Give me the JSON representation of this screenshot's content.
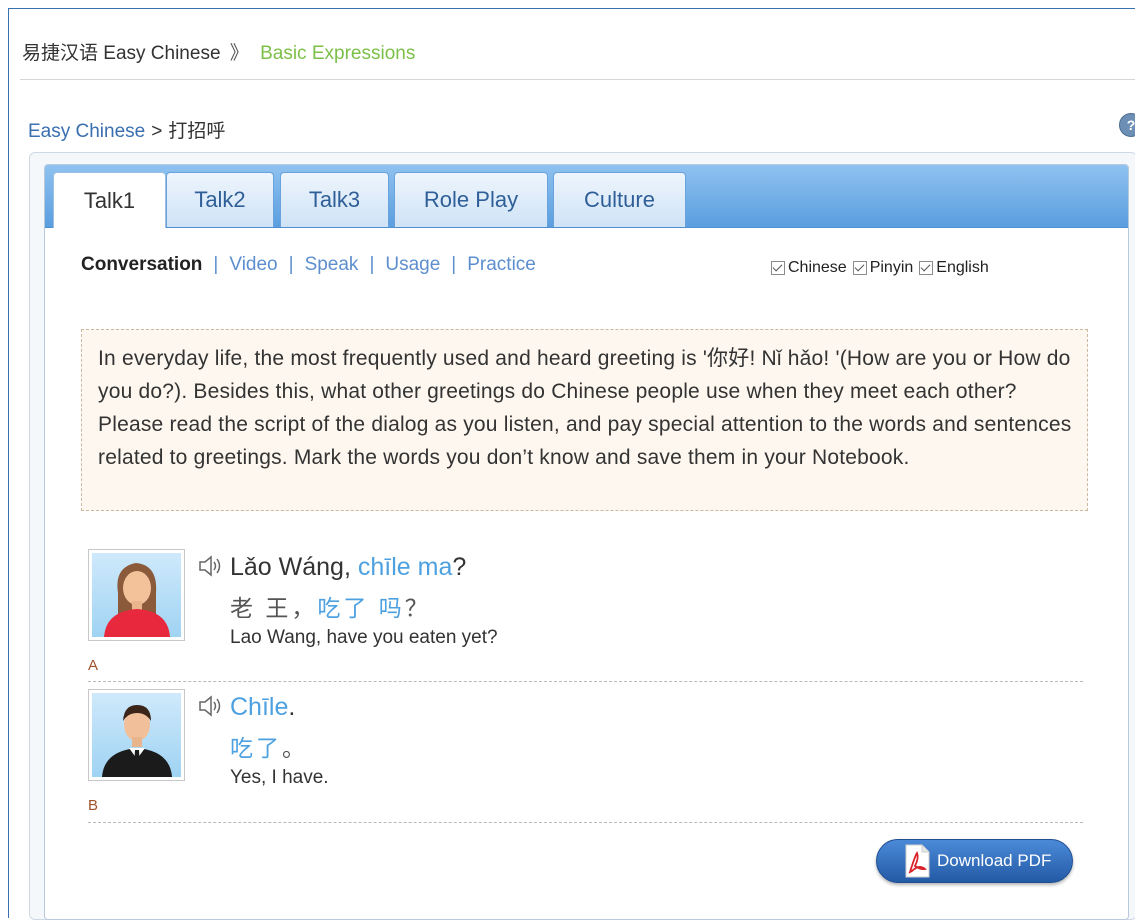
{
  "header": {
    "site_title": "易捷汉语 Easy Chinese",
    "separator": "》",
    "section": "Basic Expressions"
  },
  "breadcrumb": {
    "root": "Easy Chinese",
    "separator": ">",
    "current": "打招呼"
  },
  "help_icon": "help-icon",
  "tabs": [
    {
      "label": "Talk1",
      "active": true
    },
    {
      "label": "Talk2",
      "active": false
    },
    {
      "label": "Talk3",
      "active": false
    },
    {
      "label": "Role Play",
      "active": false
    },
    {
      "label": "Culture",
      "active": false
    }
  ],
  "subnav": {
    "active": "Conversation",
    "items": [
      "Video",
      "Speak",
      "Usage",
      "Practice"
    ],
    "separator": "|"
  },
  "toggles": [
    {
      "label": "Chinese",
      "checked": true
    },
    {
      "label": "Pinyin",
      "checked": true
    },
    {
      "label": "English",
      "checked": true
    }
  ],
  "intro_text": "In everyday life, the most frequently used and heard greeting is '你好! Nǐ hǎo! '(How are you or How do you do?). Besides this, what other greetings do Chinese people use when they meet each other? Please read the script of the dialog as you listen, and pay special attention to the words and sentences related to greetings. Mark the words you don’t know and save them in your Notebook.",
  "dialog": [
    {
      "speaker": "A",
      "avatar": "female-avatar",
      "pinyin": {
        "a": "Lǎo Wáng, ",
        "b": "chīle",
        "c": " ",
        "d": "ma",
        "e": "?"
      },
      "hanzi": {
        "a": "老 王，",
        "b": "吃了 吗",
        "c": "？"
      },
      "english": "Lao Wang, have you eaten yet?"
    },
    {
      "speaker": "B",
      "avatar": "male-avatar",
      "pinyin": {
        "a": "",
        "b": "Chīle",
        "c": "."
      },
      "hanzi": {
        "a": "",
        "b": "吃了",
        "c": "。"
      },
      "english": "Yes, I have."
    }
  ],
  "download_button": {
    "label": "Download PDF",
    "icon": "pdf-icon"
  },
  "colors": {
    "accent_green": "#7cc049",
    "link_blue": "#3a6fb0",
    "highlight_blue": "#4ea1e0",
    "tab_bar": "#5a9edf",
    "intro_bg": "#fdf7ef"
  }
}
